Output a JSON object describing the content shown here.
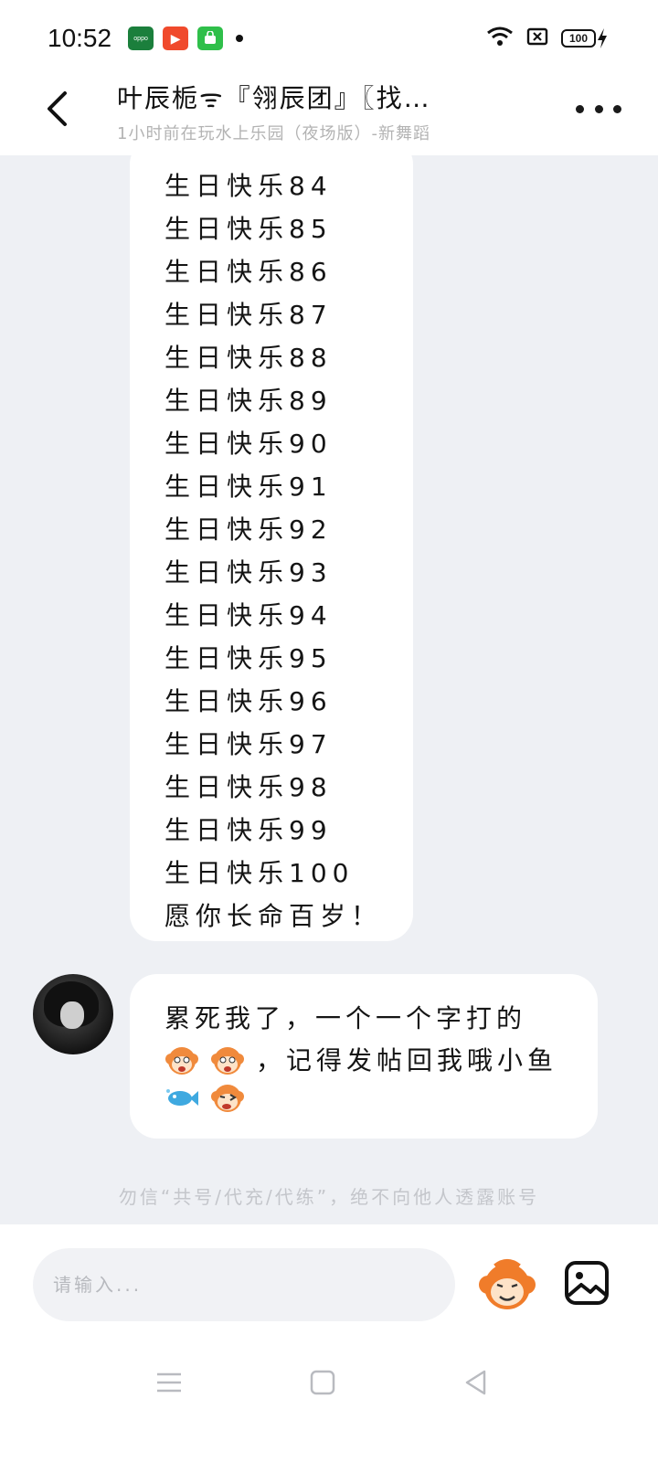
{
  "status_bar": {
    "time": "10:52",
    "app_icons": [
      "oppo-store-icon",
      "video-app-icon",
      "shop-app-icon"
    ],
    "oppo_badge_text": "oppo",
    "battery": "100"
  },
  "header": {
    "back_icon": "chevron-left-icon",
    "title": "叶辰栀ᯤ『翎辰团』〖找…",
    "subtitle": "1小时前在玩水上乐园（夜场版）-新舞蹈",
    "more_icon": "more-dots-icon"
  },
  "messages": {
    "birthday_lines": [
      "生日快乐84",
      "生日快乐85",
      "生日快乐86",
      "生日快乐87",
      "生日快乐88",
      "生日快乐89",
      "生日快乐90",
      "生日快乐91",
      "生日快乐92",
      "生日快乐93",
      "生日快乐94",
      "生日快乐95",
      "生日快乐96",
      "生日快乐97",
      "生日快乐98",
      "生日快乐99",
      "生日快乐100",
      "愿你长命百岁！"
    ],
    "reply": {
      "line1": "累死我了，一个一个字打的",
      "line2_text": "，记得发帖回我哦小鱼",
      "emoji_names": [
        "monkey-face-emoji",
        "monkey-face-emoji",
        "fish-emoji",
        "monkey-wink-emoji"
      ]
    },
    "notice": "勿信“共号/代充/代练”，绝不向他人透露账号"
  },
  "input": {
    "placeholder": "请输入...",
    "sticker_icon": "monkey-sticker-icon",
    "image_icon": "image-icon"
  },
  "nav": {
    "menu_icon": "menu-icon",
    "home_icon": "home-square-icon",
    "back_icon": "back-triangle-icon"
  },
  "colors": {
    "background": "#eef0f4",
    "bubble": "#ffffff",
    "subtitle": "#b3b3b3",
    "notice": "#c4c6cb"
  }
}
